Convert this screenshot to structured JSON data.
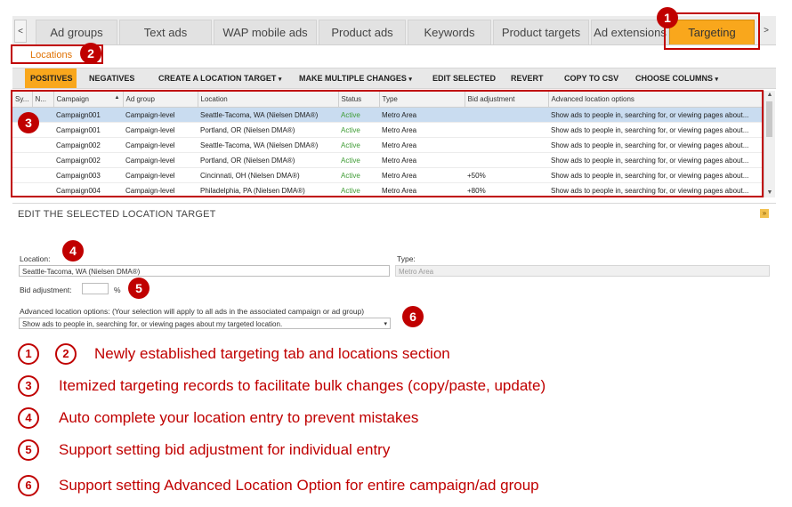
{
  "tabs": [
    {
      "label": "Ad groups"
    },
    {
      "label": "Text ads"
    },
    {
      "label": "WAP mobile ads"
    },
    {
      "label": "Product ads"
    },
    {
      "label": "Keywords"
    },
    {
      "label": "Product targets"
    },
    {
      "label": "Ad extensions"
    },
    {
      "label": "Targeting"
    }
  ],
  "tab_scroll": {
    "left": "<",
    "right": ">"
  },
  "subtab": {
    "label": "Locations"
  },
  "toolbar": {
    "positives": "POSITIVES",
    "negatives": "NEGATIVES",
    "create": "CREATE A LOCATION TARGET",
    "multiple": "MAKE MULTIPLE CHANGES",
    "edit_selected": "EDIT SELECTED",
    "revert": "REVERT",
    "copy_csv": "COPY TO CSV",
    "choose_columns": "CHOOSE COLUMNS",
    "dropdown_glyph": "▾"
  },
  "grid": {
    "columns": [
      "Sy...",
      "N...",
      "Campaign",
      "Ad group",
      "Location",
      "Status",
      "Type",
      "Bid adjustment",
      "Advanced location options"
    ],
    "sort_glyph": "▲",
    "rows": [
      [
        "",
        "",
        "Campaign001",
        "Campaign-level",
        "Seattle-Tacoma, WA (Nielsen DMA®)",
        "Active",
        "Metro Area",
        "",
        "Show ads to people in, searching for, or viewing pages about..."
      ],
      [
        "",
        "",
        "Campaign001",
        "Campaign-level",
        "Portland, OR (Nielsen DMA®)",
        "Active",
        "Metro Area",
        "",
        "Show ads to people in, searching for, or viewing pages about..."
      ],
      [
        "",
        "",
        "Campaign002",
        "Campaign-level",
        "Seattle-Tacoma, WA (Nielsen DMA®)",
        "Active",
        "Metro Area",
        "",
        "Show ads to people in, searching for, or viewing pages about..."
      ],
      [
        "",
        "",
        "Campaign002",
        "Campaign-level",
        "Portland, OR (Nielsen DMA®)",
        "Active",
        "Metro Area",
        "",
        "Show ads to people in, searching for, or viewing pages about..."
      ],
      [
        "",
        "",
        "Campaign003",
        "Campaign-level",
        "Cincinnati, OH (Nielsen DMA®)",
        "Active",
        "Metro Area",
        "+50%",
        "Show ads to people in, searching for, or viewing pages about..."
      ],
      [
        "",
        "",
        "Campaign004",
        "Campaign-level",
        "Philadelphia, PA (Nielsen DMA®)",
        "Active",
        "Metro Area",
        "+80%",
        "Show ads to people in, searching for, or viewing pages about..."
      ]
    ],
    "scroll_up": "▲",
    "scroll_down": "▼"
  },
  "edit_panel": {
    "title": "EDIT THE SELECTED LOCATION TARGET",
    "collapse_glyph": "»",
    "location_label": "Location:",
    "location_value": "Seattle-Tacoma, WA (Nielsen DMA®)",
    "type_label": "Type:",
    "type_value": "Metro Area",
    "bid_label": "Bid adjustment:",
    "bid_value": "",
    "bid_unit": "%",
    "advanced_label": "Advanced location options: (Your selection will apply to all ads in the associated campaign or ad group)",
    "advanced_value": "Show ads to people in, searching for, or viewing pages about my targeted location.",
    "dropdown_glyph": "▾"
  },
  "callouts": [
    "1",
    "2",
    "3",
    "4",
    "5",
    "6"
  ],
  "legend": [
    {
      "nums": [
        "1",
        "2"
      ],
      "text": "Newly established targeting tab and locations section"
    },
    {
      "nums": [
        "3"
      ],
      "text": "Itemized targeting records to facilitate bulk changes (copy/paste, update)"
    },
    {
      "nums": [
        "4"
      ],
      "text": "Auto complete your location entry to prevent mistakes"
    },
    {
      "nums": [
        "5"
      ],
      "text": "Support setting bid adjustment for individual entry"
    },
    {
      "nums": [
        "6"
      ],
      "text": "Support setting Advanced Location Option for entire campaign/ad group"
    }
  ],
  "colors": {
    "accent_orange": "#f9a71c",
    "annotation_red": "#c00000",
    "selected_row": "#c9dcf0",
    "active_status": "#3f9c35"
  }
}
